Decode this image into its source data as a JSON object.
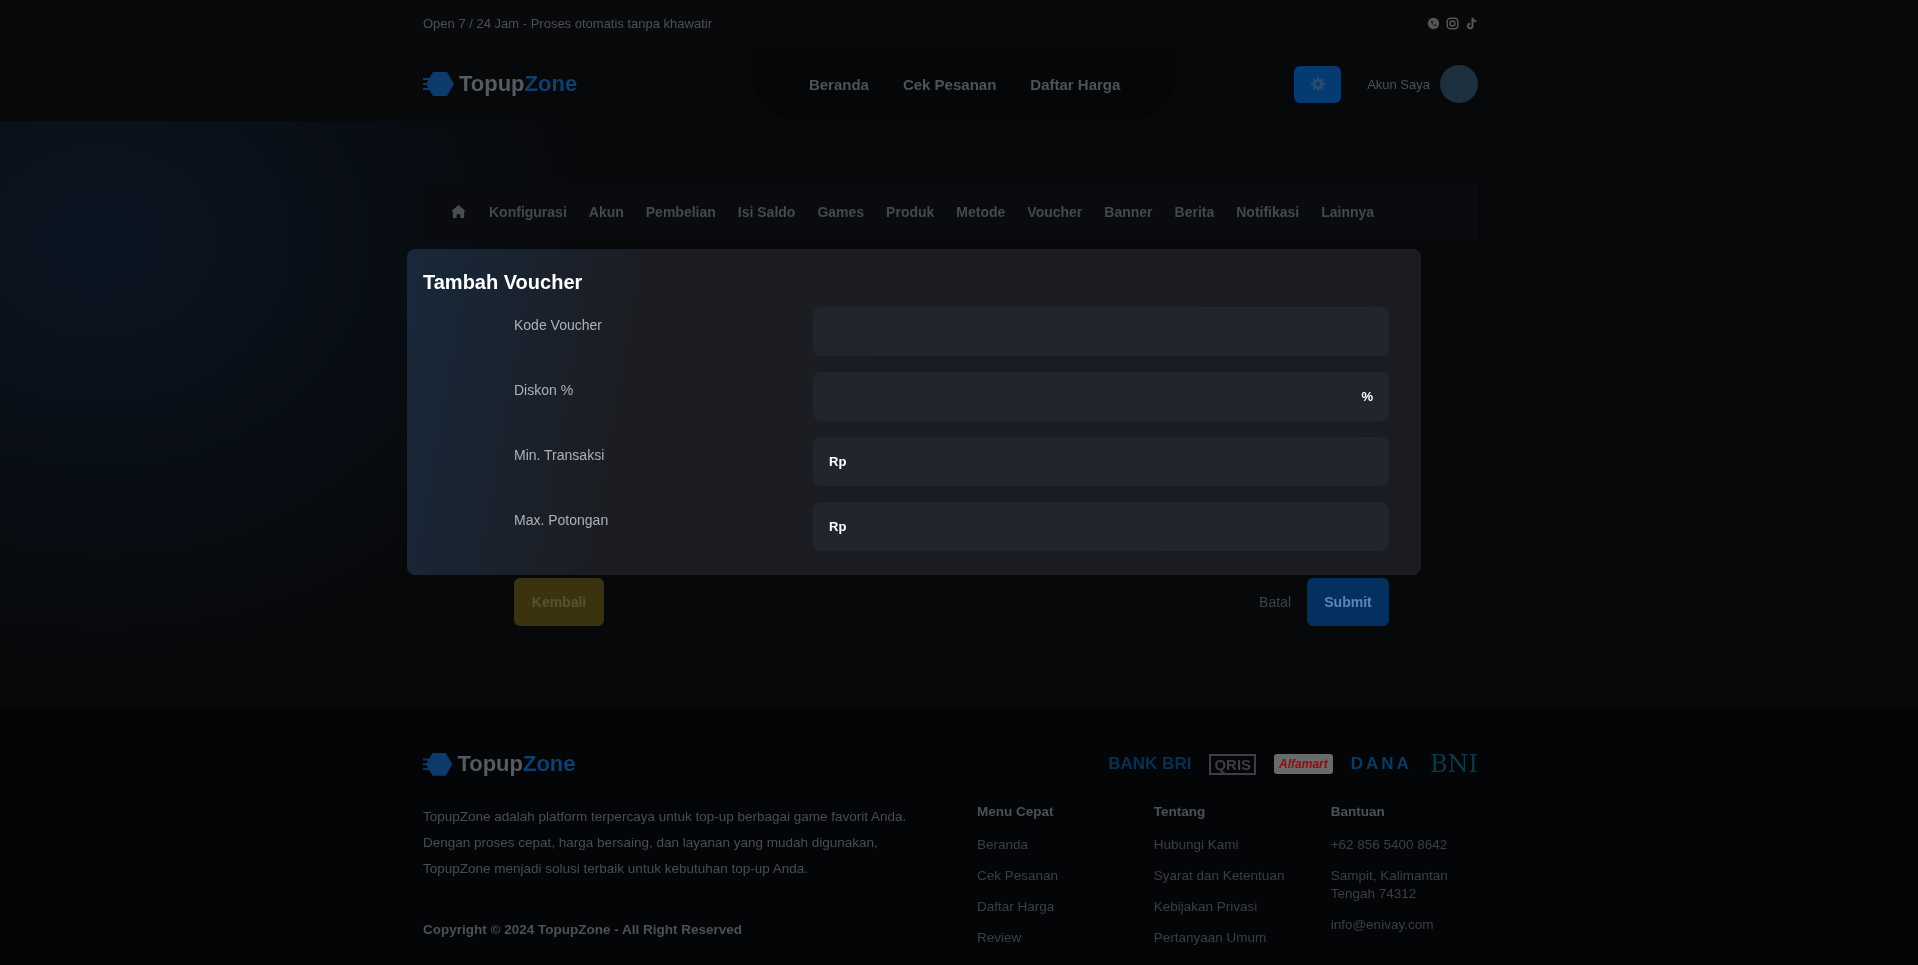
{
  "top_bar": {
    "text": "Open 7 / 24 Jam - Proses otomatis tanpa khawatir"
  },
  "brand": {
    "first": "Topup",
    "second": "Zone"
  },
  "header": {
    "nav": [
      "Beranda",
      "Cek Pesanan",
      "Daftar Harga"
    ],
    "account": "Akun Saya"
  },
  "admin_menu": [
    "Konfigurasi",
    "Akun",
    "Pembelian",
    "Isi Saldo",
    "Games",
    "Produk",
    "Metode",
    "Voucher",
    "Banner",
    "Berita",
    "Notifikasi",
    "Lainnya"
  ],
  "modal": {
    "title": "Tambah Voucher",
    "fields": [
      {
        "label": "Kode Voucher",
        "kind": "text"
      },
      {
        "label": "Diskon %",
        "kind": "suffix",
        "addon": "%"
      },
      {
        "label": "Min. Transaksi",
        "kind": "prefix",
        "addon": "Rp"
      },
      {
        "label": "Max. Potongan",
        "kind": "prefix",
        "addon": "Rp"
      }
    ]
  },
  "actions": {
    "back": "Kembali",
    "cancel": "Batal",
    "submit": "Submit"
  },
  "footer": {
    "brand": {
      "first": "Topup",
      "second": "Zone"
    },
    "description": "TopupZone adalah platform terpercaya untuk top-up berbagai game favorit Anda. Dengan proses cepat, harga bersaing, dan layanan yang mudah digunakan, TopupZone menjadi solusi terbaik untuk kebutuhan top-up Anda.",
    "copyright": "Copyright © 2024 TopupZone - All Right Reserved",
    "payment_logos": [
      "BANK BRI",
      "QRIS",
      "Alfamart",
      "DANA",
      "BNI"
    ],
    "columns": [
      {
        "title": "Menu Cepat",
        "items": [
          "Beranda",
          "Cek Pesanan",
          "Daftar Harga",
          "Review"
        ]
      },
      {
        "title": "Tentang",
        "items": [
          "Hubungi Kami",
          "Syarat dan Ketentuan",
          "Kebijakan Privasi",
          "Pertanyaan Umum"
        ]
      },
      {
        "title": "Bantuan",
        "items": [
          "+62 856 5400 8642",
          "Sampit, Kalimantan Tengah 74312",
          "info@enivay.com"
        ]
      }
    ]
  }
}
